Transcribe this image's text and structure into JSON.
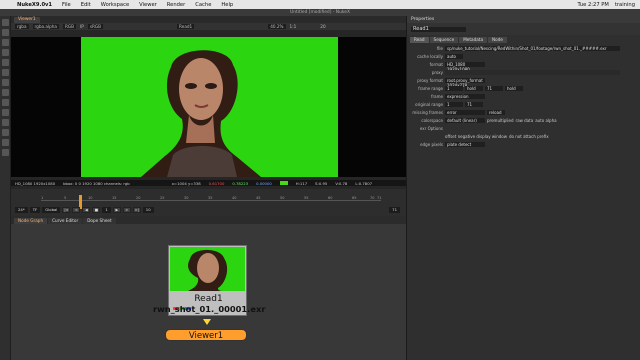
{
  "menubar": {
    "app": "NukeX9.0v1",
    "items": [
      "File",
      "Edit",
      "Workspace",
      "Viewer",
      "Render",
      "Cache",
      "Help"
    ],
    "clock": "Tue 2:27 PM",
    "user": "training"
  },
  "window": {
    "title": "Untitled [modified] - NukeX"
  },
  "viewer": {
    "tab": "Viewer1",
    "toolbar": {
      "channels": "rgba",
      "alpha": "rgba.alpha",
      "colorspace": "RGB",
      "ip": "IP",
      "display": "sRGB",
      "read": "Read1",
      "zoom": "40.2%",
      "ratio": "1:1",
      "frame": "20"
    },
    "status": {
      "resolution": "HD_1080 1920x1080",
      "bbox": "bbox: 0 0 1920 1080 channels: rgb",
      "xy": "x=1004 y=338",
      "r": "0.61700",
      "g": "0.78223",
      "b": "0.00000",
      "h": "H:117",
      "s": "S:0.95",
      "v": "V:0.78",
      "l": "L:0.7807"
    }
  },
  "timeline": {
    "ticks": [
      "1",
      "5",
      "10",
      "15",
      "20",
      "25",
      "30",
      "35",
      "40",
      "45",
      "50",
      "55",
      "60",
      "65",
      "70",
      "71"
    ],
    "fps": "24*",
    "tf": "TF",
    "global": "Global",
    "frame": "1",
    "end": "71",
    "step": "10"
  },
  "nodegraph": {
    "tabs": [
      "Node Graph",
      "Curve Editor",
      "Dope Sheet"
    ],
    "read_name": "Read1",
    "read_file": "rwn_shot_01._00001.exr",
    "viewer_name": "Viewer1"
  },
  "properties": {
    "title": "Properties",
    "node_name": "Read1",
    "tabs": [
      "Read",
      "Sequence",
      "Metadata",
      "Node"
    ],
    "rows": [
      {
        "label": "file",
        "value": "sp/nuke_tutorial/Nescing/RedWithin/Shot_01/footage/rwn_shot_01._#####.exr"
      },
      {
        "label": "cache locally",
        "value": "auto"
      },
      {
        "label": "format",
        "value": "HD_1080 1920x1080"
      },
      {
        "label": "proxy",
        "value": ""
      },
      {
        "label": "proxy format",
        "value": "root.proxy_format 1024x778"
      },
      {
        "label": "frame range",
        "value": "1"
      },
      {
        "label": "frame",
        "value": "expression"
      },
      {
        "label": "original range",
        "value": "1"
      },
      {
        "label": "missing frames",
        "value": "error"
      },
      {
        "label": "colorspace",
        "value": "default (linear)"
      },
      {
        "label": "exr Options",
        "value": ""
      },
      {
        "label": "edge pixels",
        "value": "plate detect"
      }
    ],
    "extras": {
      "hold": "hold",
      "range_end": "71",
      "reload": "reload",
      "premultiplied": "premultiplied",
      "raw_data": "raw data",
      "auto_alpha": "auto alpha",
      "offset": "offset negative display window",
      "no_prefix": "do not attach prefix"
    }
  }
}
